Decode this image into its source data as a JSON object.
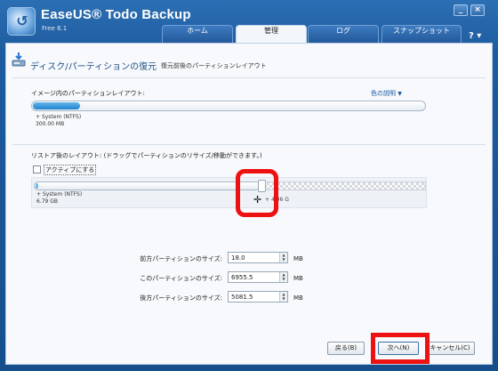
{
  "app": {
    "title": "EaseUS® Todo Backup",
    "subtitle": "Free 6.1",
    "help_label": "?",
    "window_controls": [
      "_",
      "×"
    ]
  },
  "tabs": [
    {
      "label": "ホーム",
      "active": false
    },
    {
      "label": "管理",
      "active": true
    },
    {
      "label": "ログ",
      "active": false
    },
    {
      "label": "スナップショット",
      "active": false
    }
  ],
  "header": {
    "icon": "restore-disk-icon",
    "title": "ディスク/パーティションの復元",
    "description": "復元前後のパーティションレイアウト"
  },
  "image_layout": {
    "label": "イメージ内のパーティションレイアウト:",
    "legend_link": "色の説明",
    "partition_name": "System (NTFS)",
    "partition_size": "300.00 MB",
    "used_fraction": 0.12
  },
  "restore_layout": {
    "label": "リストア後のレイアウト: (ドラッグでパーティションのリサイズ/移動ができます。)",
    "active_checkbox_label": "アクティブにする",
    "active_checked": false,
    "partition_name": "System (NTFS)",
    "partition_size": "6.79 GB",
    "free_size": "4.96 G"
  },
  "size_fields": [
    {
      "label": "前方パーティションのサイズ:",
      "value": "18.0",
      "unit": "MB"
    },
    {
      "label": "このパーティションのサイズ:",
      "value": "6955.5",
      "unit": "MB"
    },
    {
      "label": "後方パーティションのサイズ:",
      "value": "5081.5",
      "unit": "MB"
    }
  ],
  "buttons": {
    "back": "戻る(B)",
    "next": "次へ(N)",
    "cancel": "キャンセル(C)"
  },
  "colors": {
    "accent": "#1f86cf",
    "highlight": "#ee1111",
    "title_bar": "#2d6fb4"
  }
}
